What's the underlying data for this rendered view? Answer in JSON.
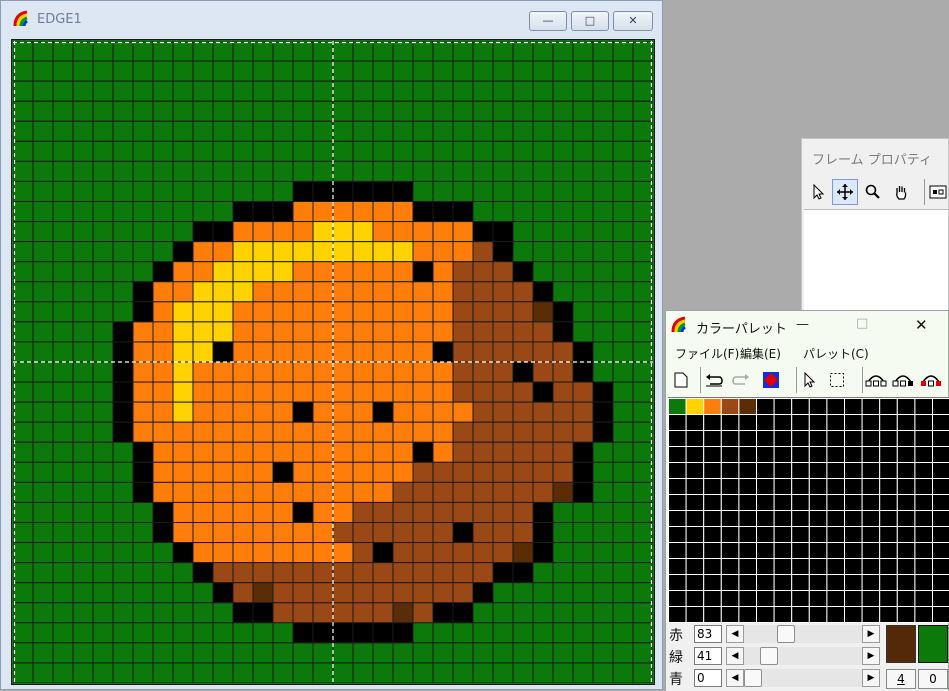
{
  "edge_window": {
    "title": "EDGE1",
    "minimize_glyph": "—",
    "maximize_glyph": "□",
    "close_glyph": "✕",
    "icon": "rainbow-app-icon"
  },
  "sprite": {
    "cols": 32,
    "rows": 32,
    "legend": {
      "G": "#0b7a0b",
      "K": "#000000",
      "O": "#ff7d0a",
      "Y": "#ffd200",
      "B": "#9a4815",
      "D": "#5a2d07"
    },
    "grid": [
      "GGGGGGGGGGGGGGGGGGGGGGGGGGGGGGGG",
      "GGGGGGGGGGGGGGGGGGGGGGGGGGGGGGGG",
      "GGGGGGGGGGGGGGGGGGGGGGGGGGGGGGGG",
      "GGGGGGGGGGGGGGGGGGGGGGGGGGGGGGGG",
      "GGGGGGGGGGGGGGGGGGGGGGGGGGGGGGGG",
      "GGGGGGGGGGGGGGGGGGGGGGGGGGGGGGGG",
      "GGGGGGGGGGGGGGGGGGGGGGGGGGGGGGGG",
      "GGGGGGGGGGGGGGKKKKKKGGGGGGGGGGGG",
      "GGGGGGGGGGGKKKOOOOOOKKKGGGGGGGGG",
      "GGGGGGGGGKKOOOOYYYOOOOOKKGGGGGGG",
      "GGGGGGGGKOOYYYYYYYYYOOOBKGGGGGGG",
      "GGGGGGGKOOYYYYOOOOOOKOBBBKGGGGGG",
      "GGGGGGKOOYYYOOOOOOOOOOBBBBKGGGGG",
      "GGGGGGKOYYYOOOOOOOOOOOBBBBDKGGGG",
      "GGGGGKOOYYYOOOOOOOOOOOBBBBBKGGGG",
      "GGGGGKOOYYKOOOOOOOOOOKBBBBBBKGGG",
      "GGGGGKOOYOOOOOOOOOOOOOBBBKBBKGGG",
      "GGGGGKOOYOOOOOOOOOOOOOBBBBKBBKGG",
      "GGGGGKOOYOOOOOKOOOKOOOOBBBBBBKGG",
      "GGGGGKOOOOOOOOOOOOOOOOBBBBBBBKGG",
      "GGGGGGKOOOOOOOOOOOOOKOBBBBBBKGGG",
      "GGGGGGKOOOOOOKOOOOOOBBBBBBBBKGGG",
      "GGGGGGKOOOOOOOOOOOOBBBBBBBBDKGGG",
      "GGGGGGGKOOOOOOKOOBBBBBBBBBKGGGGG",
      "GGGGGGGKOOOOOOOOBBBBBBKBBBKGGGGG",
      "GGGGGGGGKOOOOOOOOBKBBBBBBDKGGGGG",
      "GGGGGGGGGKBBBBBBBBBBBBBBKKGGGGGG",
      "GGGGGGGGGGKBDBBBBBBBBBBKGGGGGGGG",
      "GGGGGGGGGGGKKBBBBBBDBKKGGGGGGGGG",
      "GGGGGGGGGGGGGGKKKKKKGGGGGGGGGGGG",
      "GGGGGGGGGGGGGGGGGGGGGGGGGGGGGGGG",
      "GGGGGGGGGGGGGGGGGGGGGGGGGGGGGGGG"
    ]
  },
  "frame_window": {
    "title": "フレーム プロパティ",
    "tools": [
      "pointer-icon",
      "move-icon",
      "zoom-icon",
      "hand-icon",
      "frame-toggle-icon"
    ]
  },
  "palette_window": {
    "title": "カラーパレット",
    "minimize_glyph": "—",
    "maximize_glyph": "□",
    "close_glyph": "✕",
    "menu": [
      "ファイル(F)",
      "編集(E)",
      "パレット(C)"
    ],
    "swatches": [
      "#0b7a0b",
      "#ffd200",
      "#ff7d0a",
      "#9a4815",
      "#5a2d07"
    ],
    "rgb": [
      {
        "label": "赤",
        "value": "83",
        "level": 0.325
      },
      {
        "label": "緑",
        "value": "41",
        "level": 0.16
      },
      {
        "label": "青",
        "value": "0",
        "level": 0.0
      }
    ],
    "current_color": "#53290a",
    "secondary_color": "#0b7a0b",
    "index_fg": "4",
    "index_bg": "0"
  }
}
